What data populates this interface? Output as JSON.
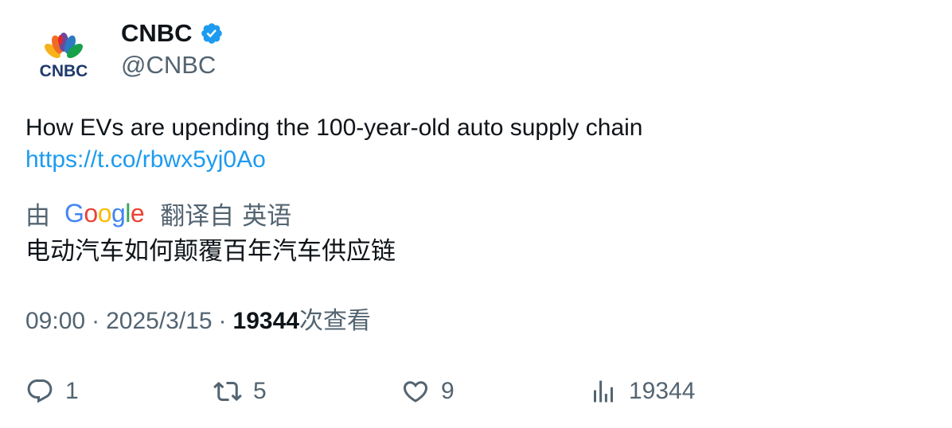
{
  "author": {
    "display_name": "CNBC",
    "handle": "@CNBC",
    "verified": true,
    "avatar_logo_text": "CNBC"
  },
  "tweet": {
    "text": "How EVs are upending the 100-year-old auto supply chain",
    "link": "https://t.co/rbwx5yj0Ao"
  },
  "translation": {
    "prefix": "由",
    "provider_letters": [
      "G",
      "o",
      "o",
      "g",
      "l",
      "e"
    ],
    "translated_from": "翻译自",
    "language": "英语",
    "text": "电动汽车如何颠覆百年汽车供应链"
  },
  "meta": {
    "time": "09:00",
    "date": "2025/3/15",
    "separator": "·",
    "views_count": "19344",
    "views_label": "次查看"
  },
  "actions": {
    "replies": "1",
    "retweets": "5",
    "likes": "9",
    "views": "19344"
  },
  "colors": {
    "link": "#1d9bf0",
    "verified_badge": "#1d9bf0",
    "secondary_text": "#536471",
    "primary_text": "#0f1419"
  }
}
